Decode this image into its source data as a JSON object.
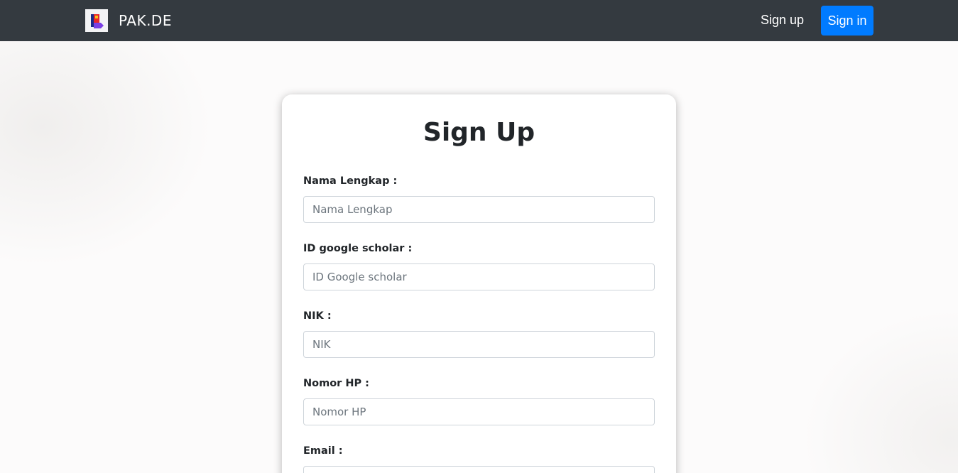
{
  "navbar": {
    "brand": "PAK.DE",
    "signup_label": "Sign up",
    "signin_label": "Sign in"
  },
  "form": {
    "title": "Sign Up",
    "fields": [
      {
        "label": "Nama Lengkap :",
        "placeholder": "Nama Lengkap",
        "value": ""
      },
      {
        "label": "ID google scholar :",
        "placeholder": "ID Google scholar",
        "value": ""
      },
      {
        "label": "NIK :",
        "placeholder": "NIK",
        "value": ""
      },
      {
        "label": "Nomor HP :",
        "placeholder": "Nomor HP",
        "value": ""
      },
      {
        "label": "Email :",
        "placeholder": "",
        "value": ""
      }
    ]
  },
  "colors": {
    "navbar_bg": "#343a40",
    "primary": "#007bff",
    "page_bg": "#fcfbfb"
  }
}
